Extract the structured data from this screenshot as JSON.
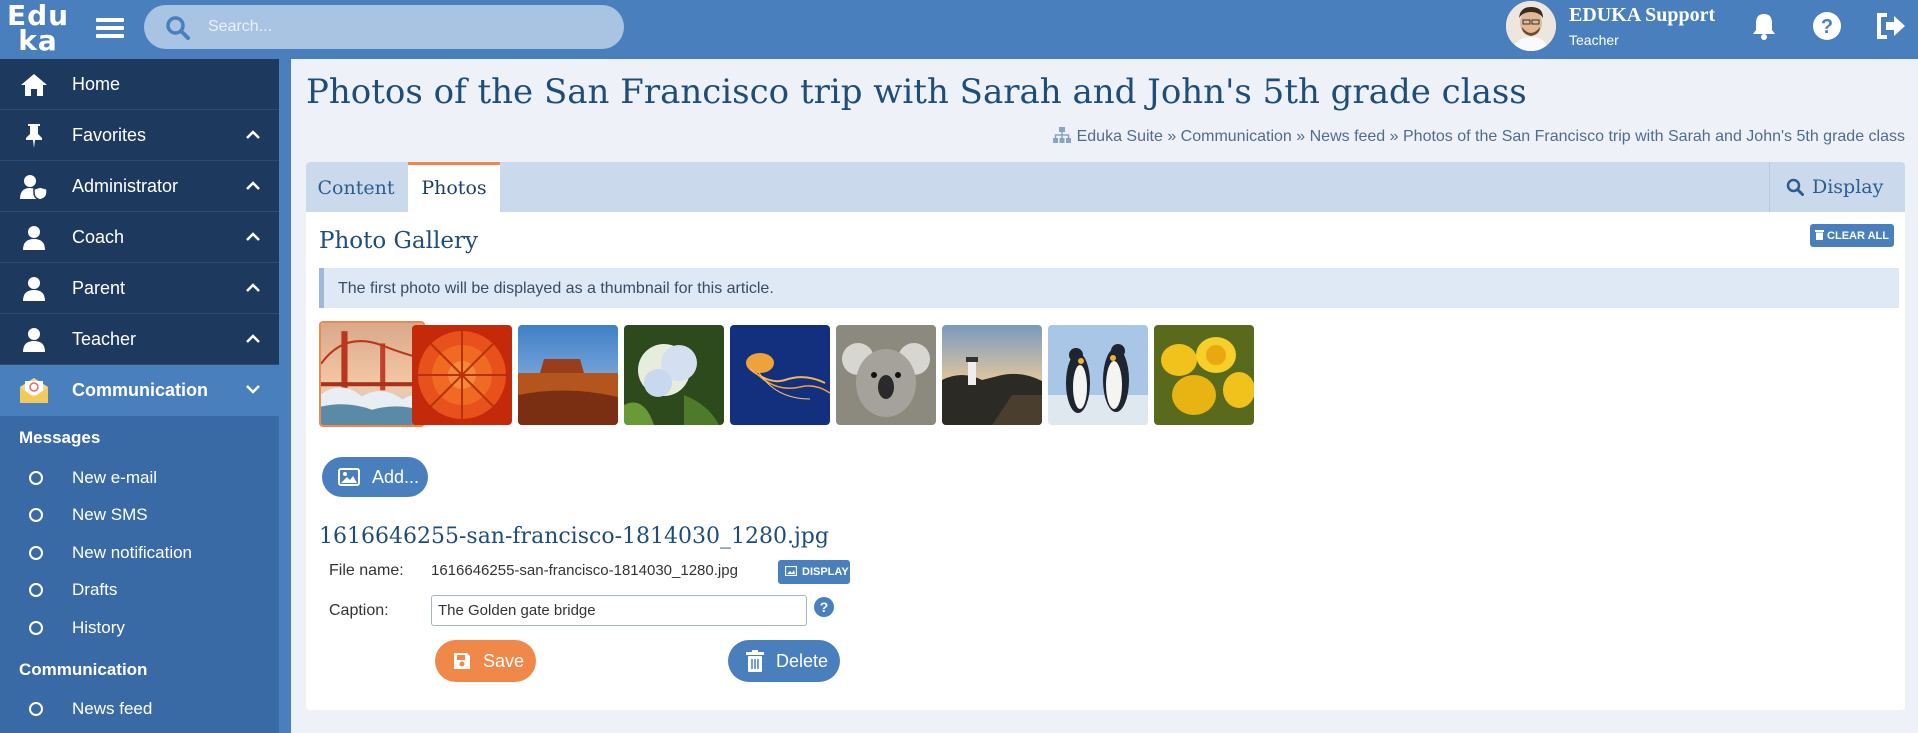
{
  "header": {
    "logo_line1": "Edu",
    "logo_line2": "ka",
    "search_placeholder": "Search...",
    "user_name": "EDUKA Support",
    "user_role": "Teacher"
  },
  "sidebar": {
    "items": [
      {
        "label": "Home",
        "icon": "home-icon"
      },
      {
        "label": "Favorites",
        "icon": "pin-icon",
        "chevron": "up"
      },
      {
        "label": "Administrator",
        "icon": "user-shield-icon",
        "chevron": "up"
      },
      {
        "label": "Coach",
        "icon": "user-icon",
        "chevron": "up"
      },
      {
        "label": "Parent",
        "icon": "user-icon",
        "chevron": "up"
      },
      {
        "label": "Teacher",
        "icon": "user-icon",
        "chevron": "up"
      },
      {
        "label": "Communication",
        "icon": "envelope-icon",
        "chevron": "down",
        "active": true
      }
    ],
    "sections": [
      {
        "title": "Messages",
        "items": [
          "New e-mail",
          "New SMS",
          "New notification",
          "Drafts",
          "History"
        ]
      },
      {
        "title": "Communication",
        "items": [
          "News feed"
        ]
      }
    ]
  },
  "page": {
    "title": "Photos of the San Francisco trip with Sarah and John's 5th grade class",
    "breadcrumb": "Eduka Suite » Communication » News feed » Photos of the San Francisco trip with Sarah and John's 5th grade class"
  },
  "tabs": {
    "content": "Content",
    "photos": "Photos",
    "active": "Photos",
    "display": "Display"
  },
  "gallery": {
    "title": "Photo Gallery",
    "clear_all": "CLEAR ALL",
    "info": "The first photo will be displayed as a thumbnail for this article.",
    "photos": [
      "golden-gate-bridge",
      "orange-flower",
      "desert-butte",
      "hydrangea",
      "jellyfish",
      "koala",
      "lighthouse",
      "penguins",
      "yellow-tulips"
    ],
    "selected_index": 0,
    "add_label": "Add..."
  },
  "file": {
    "heading": "1616646255-san-francisco-1814030_1280.jpg",
    "file_name_label": "File name:",
    "file_name": "1616646255-san-francisco-1814030_1280.jpg",
    "display_label": "DISPLAY",
    "caption_label": "Caption:",
    "caption": "The Golden gate bridge",
    "save_label": "Save",
    "delete_label": "Delete"
  },
  "colors": {
    "primary": "#4a7fbd",
    "sidebar": "#1d3a5e",
    "accent": "#f0884a"
  }
}
